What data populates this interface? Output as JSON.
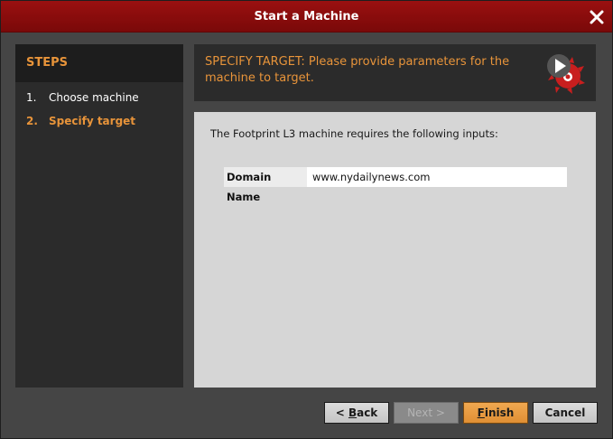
{
  "window": {
    "title": "Start a Machine"
  },
  "steps": {
    "header": "STEPS",
    "items": [
      {
        "num": "1.",
        "label": "Choose machine"
      },
      {
        "num": "2.",
        "label": "Specify target"
      }
    ]
  },
  "banner": {
    "text": "SPECIFY TARGET: Please provide parameters for the machine to target."
  },
  "content": {
    "intro": "The Footprint L3 machine requires the following inputs:",
    "fields": [
      {
        "label": "Domain Name",
        "value": "www.nydailynews.com"
      }
    ]
  },
  "buttons": {
    "back": {
      "prefix": "< ",
      "mnemonic": "B",
      "rest": "ack"
    },
    "next": "Next >",
    "finish": {
      "mnemonic": "F",
      "rest": "inish"
    },
    "cancel": "Cancel"
  },
  "colors": {
    "titlebar": "#8a0c0c",
    "accent": "#e8943a",
    "panel_dark": "#2b2b2b",
    "content_bg": "#d6d6d6"
  },
  "icons": {
    "close": "close-icon",
    "logo": "maltego-logo-icon"
  }
}
